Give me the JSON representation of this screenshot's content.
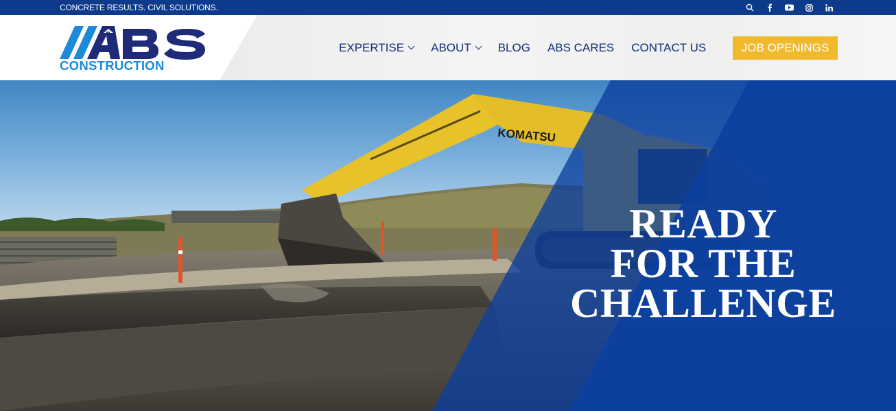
{
  "topbar": {
    "tagline": "CONCRETE RESULTS. CIVIL SOLUTIONS.",
    "icons": [
      "search-icon",
      "facebook-icon",
      "youtube-icon",
      "instagram-icon",
      "linkedin-icon"
    ]
  },
  "logo": {
    "letters": "ABS",
    "wordmark": "CONSTRUCTION"
  },
  "nav": {
    "items": [
      {
        "label": "EXPERTISE",
        "dropdown": true
      },
      {
        "label": "ABOUT",
        "dropdown": true
      },
      {
        "label": "BLOG",
        "dropdown": false
      },
      {
        "label": "ABS CARES",
        "dropdown": false
      },
      {
        "label": "CONTACT US",
        "dropdown": false
      }
    ],
    "cta": "JOB OPENINGS"
  },
  "hero": {
    "lines": [
      "READY",
      "FOR THE",
      "CHALLENGE"
    ],
    "excavator_brand": "KOMATSU"
  },
  "colors": {
    "brand_blue": "#0d3a8a",
    "nav_text": "#0d2f7a",
    "accent_light_blue": "#1c8ad6",
    "cta_yellow": "#f0b92e",
    "overlay_blue": "#0c3f9e"
  }
}
